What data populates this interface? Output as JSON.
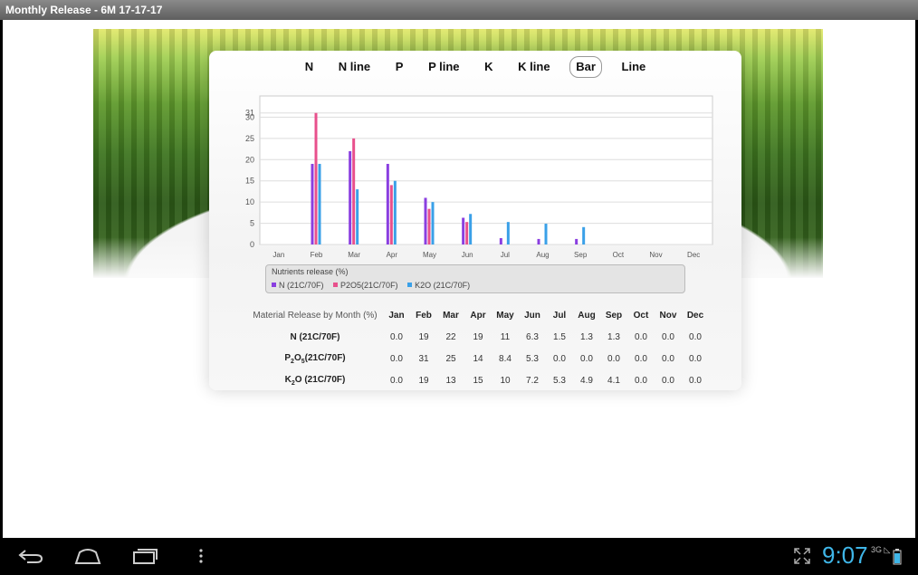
{
  "window": {
    "title": "Monthly Release - 6M 17-17-17"
  },
  "tabs": [
    {
      "label": "N",
      "active": false
    },
    {
      "label": "N line",
      "active": false
    },
    {
      "label": "P",
      "active": false
    },
    {
      "label": "P line",
      "active": false
    },
    {
      "label": "K",
      "active": false
    },
    {
      "label": "K line",
      "active": false
    },
    {
      "label": "Bar",
      "active": true
    },
    {
      "label": "Line",
      "active": false
    }
  ],
  "chart_data": {
    "type": "bar",
    "categories": [
      "Jan",
      "Feb",
      "Mar",
      "Apr",
      "May",
      "Jun",
      "Jul",
      "Aug",
      "Sep",
      "Oct",
      "Nov",
      "Dec"
    ],
    "yticks": [
      0,
      5,
      10,
      15,
      20,
      25,
      30,
      31
    ],
    "ylim": [
      0,
      35
    ],
    "legend_title": "Nutrients release (%)",
    "series": [
      {
        "name": "N (21C/70F)",
        "color": "#8a3fe0",
        "values": [
          0,
          19,
          22,
          19,
          11,
          6.3,
          1.5,
          1.3,
          1.3,
          0,
          0,
          0
        ]
      },
      {
        "name": "P2O5(21C/70F)",
        "color": "#e8508c",
        "values": [
          0,
          31,
          25,
          14,
          8.4,
          5.3,
          0,
          0,
          0,
          0,
          0,
          0
        ]
      },
      {
        "name": "K2O (21C/70F)",
        "color": "#3aa0e8",
        "values": [
          0,
          19,
          13,
          15,
          10,
          7.2,
          5.3,
          4.9,
          4.1,
          0,
          0,
          0
        ]
      }
    ],
    "grid": true
  },
  "table": {
    "caption": "Material Release by Month (%)",
    "months": [
      "Jan",
      "Feb",
      "Mar",
      "Apr",
      "May",
      "Jun",
      "Jul",
      "Aug",
      "Sep",
      "Oct",
      "Nov",
      "Dec"
    ],
    "rows": [
      {
        "label_main": "N (21C/70F)",
        "label_parts": [
          "N (21C/70F)"
        ],
        "values": [
          "0.0",
          "19",
          "22",
          "19",
          "11",
          "6.3",
          "1.5",
          "1.3",
          "1.3",
          "0.0",
          "0.0",
          "0.0"
        ]
      },
      {
        "label_parts": [
          "P",
          "2",
          "O",
          "5",
          "(21C/70F)"
        ],
        "values": [
          "0.0",
          "31",
          "25",
          "14",
          "8.4",
          "5.3",
          "0.0",
          "0.0",
          "0.0",
          "0.0",
          "0.0",
          "0.0"
        ]
      },
      {
        "label_parts": [
          "K",
          "2",
          "O (21C/70F)"
        ],
        "values": [
          "0.0",
          "19",
          "13",
          "15",
          "10",
          "7.2",
          "5.3",
          "4.9",
          "4.1",
          "0.0",
          "0.0",
          "0.0"
        ]
      }
    ]
  },
  "statusbar": {
    "time": "9:07",
    "network": "3G"
  },
  "icons": {
    "back": "back-icon",
    "home": "home-icon",
    "recents": "recents-icon",
    "menu": "overflow-menu-icon",
    "fullscreen": "fullscreen-icon"
  }
}
